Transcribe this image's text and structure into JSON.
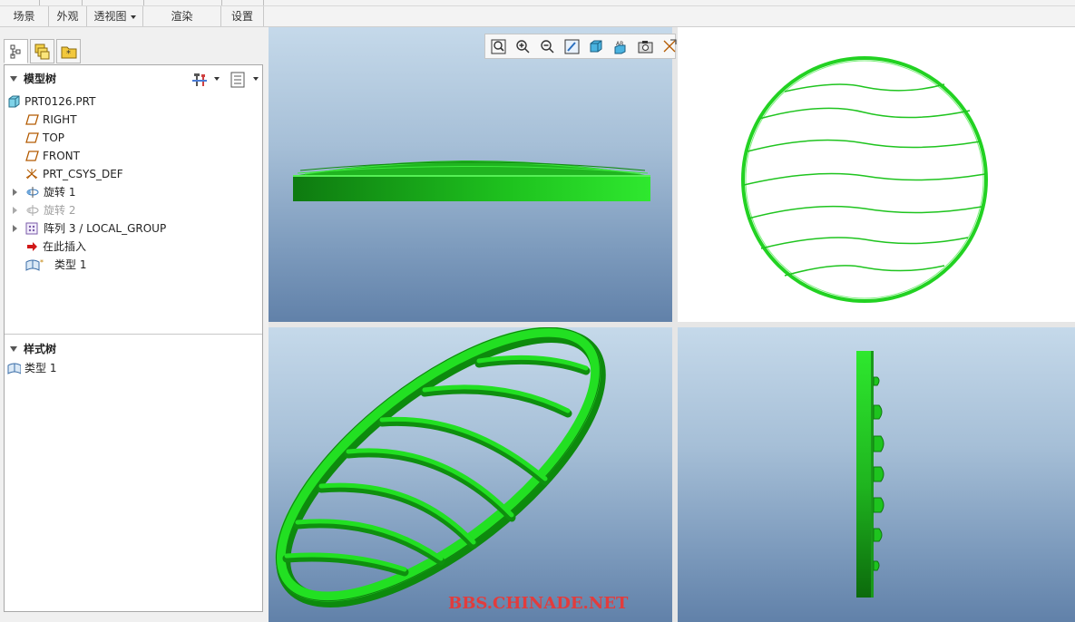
{
  "ribbon": {
    "groups": [
      "场景",
      "外观",
      "透视图",
      "渲染",
      "设置"
    ]
  },
  "model_tree": {
    "header": "模型树",
    "items": [
      {
        "label": "PRT0126.PRT",
        "icon": "part-icon"
      },
      {
        "label": "RIGHT",
        "icon": "datum-plane-icon"
      },
      {
        "label": "TOP",
        "icon": "datum-plane-icon"
      },
      {
        "label": "FRONT",
        "icon": "datum-plane-icon"
      },
      {
        "label": "PRT_CSYS_DEF",
        "icon": "csys-icon"
      },
      {
        "label": "旋转 1",
        "icon": "revolve-icon"
      },
      {
        "label": "旋转 2",
        "icon": "revolve-icon"
      },
      {
        "label": "阵列 3 / LOCAL_GROUP",
        "icon": "pattern-icon"
      },
      {
        "label": "在此插入",
        "icon": "insert-arrow-icon"
      },
      {
        "label": "类型 1",
        "icon": "style-icon"
      }
    ]
  },
  "style_tree": {
    "header": "样式树",
    "items": [
      {
        "label": "类型 1",
        "icon": "style-icon"
      }
    ]
  },
  "watermark": "BBS.CHINADE.NET",
  "colors": {
    "model_green": "#22e022",
    "model_dark_green": "#0e7a10",
    "viewport_top": "#c5d9ea",
    "viewport_bottom": "#6181a9",
    "watermark_red": "#e23c3c"
  }
}
